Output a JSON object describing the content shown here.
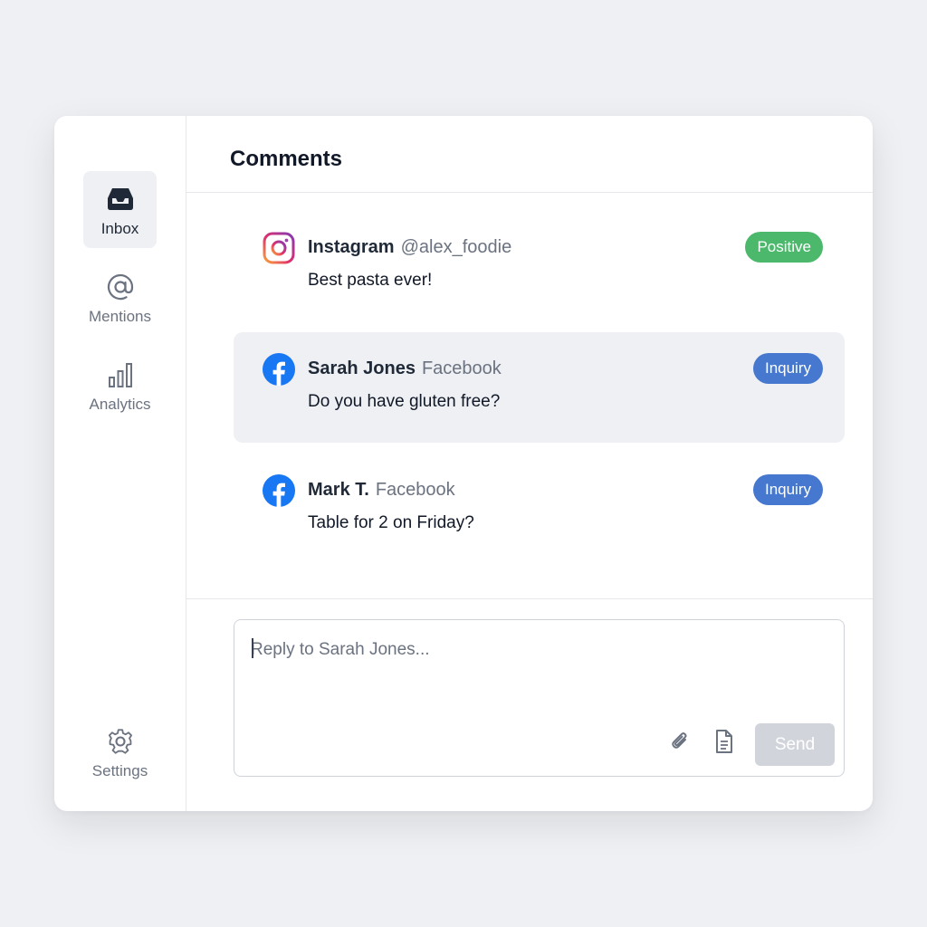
{
  "sidebar": {
    "items": [
      {
        "label": "Inbox",
        "icon": "inbox-icon",
        "active": true
      },
      {
        "label": "Mentions",
        "icon": "at-sign-icon",
        "active": false
      },
      {
        "label": "Analytics",
        "icon": "bar-chart-icon",
        "active": false
      }
    ],
    "settings": {
      "label": "Settings",
      "icon": "gear-icon"
    }
  },
  "header": {
    "title": "Comments"
  },
  "comments": [
    {
      "platform": "Instagram",
      "name": "Instagram",
      "handle": "@alex_foodie",
      "text": "Best pasta ever!",
      "tag": "Positive",
      "tag_color": "#4cb86c",
      "icon": "instagram-icon",
      "selected": false
    },
    {
      "platform": "Facebook",
      "name": "Sarah Jones",
      "handle": "Facebook",
      "text": "Do you have gluten free?",
      "tag": "Inquiry",
      "tag_color": "#4678d0",
      "icon": "facebook-icon",
      "selected": true
    },
    {
      "platform": "Facebook",
      "name": "Mark T.",
      "handle": "Facebook",
      "text": "Table for 2 on Friday?",
      "tag": "Inquiry",
      "tag_color": "#4678d0",
      "icon": "facebook-icon",
      "selected": false
    }
  ],
  "reply": {
    "placeholder": "Reply to Sarah Jones...",
    "value": "",
    "send_label": "Send"
  },
  "colors": {
    "background": "#eef0f3",
    "positive": "#4cb86c",
    "inquiry": "#4678d0",
    "facebook": "#1877f2",
    "send_disabled": "#d1d5db"
  }
}
